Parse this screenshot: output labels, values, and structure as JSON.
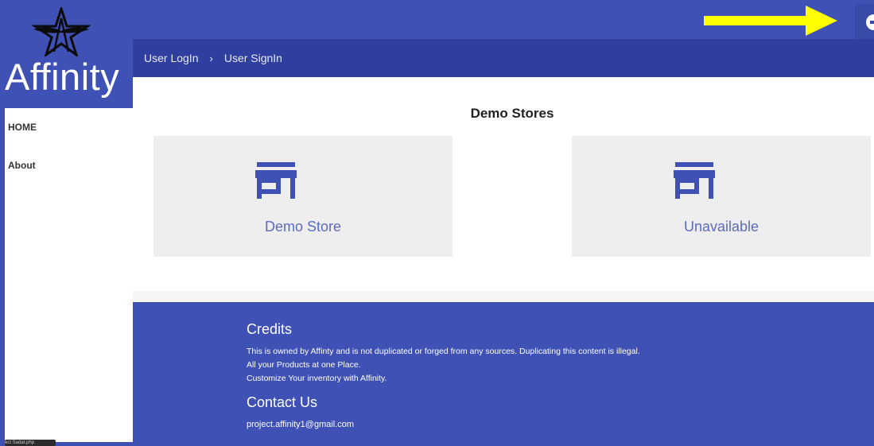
{
  "brand": {
    "name": "Affinity"
  },
  "sidebar": {
    "items": [
      {
        "label": "HOME"
      },
      {
        "label": "About"
      }
    ],
    "tooltip": "ect Sadar.php"
  },
  "breadcrumb": {
    "items": [
      "User LogIn",
      "User SignIn"
    ],
    "separator": "›"
  },
  "main": {
    "title": "Demo Stores",
    "stores": [
      {
        "label": "Demo Store",
        "icon": "store-icon"
      },
      {
        "label": "Unavailable",
        "icon": "store-icon"
      }
    ]
  },
  "footer": {
    "credits_title": "Credits",
    "credits_lines": [
      "This is owned by Affinty and is not duplicated or forged from any sources. Duplicating this content is illegal.",
      "All your Products at one Place.",
      "Customize Your inventory with Affinity."
    ],
    "contact_title": "Contact Us",
    "contact_email": "project.affinity1@gmail.com"
  },
  "colors": {
    "primary": "#3f51b5",
    "primary_dark": "#303f9f",
    "accent_text": "#5c6bc0",
    "annotation_arrow": "#ffff00"
  }
}
